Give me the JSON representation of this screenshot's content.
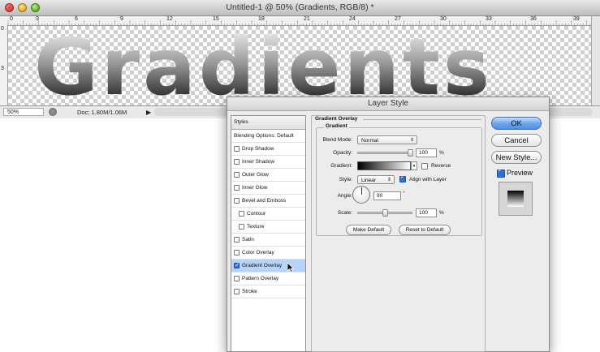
{
  "document": {
    "title": "Untitled-1 @ 50% (Gradients, RGB/8) *",
    "art_text": "Gradients",
    "ruler_marks": [
      "0",
      "3",
      "6",
      "9",
      "12",
      "15",
      "18",
      "21",
      "24",
      "27",
      "30",
      "33",
      "36",
      "39"
    ],
    "ruler_v_marks": [
      "0",
      "3"
    ],
    "status": {
      "zoom": "50%",
      "doc_info": "Doc: 1.80M/1.06M",
      "arrow": "▶"
    }
  },
  "dialog": {
    "title": "Layer Style",
    "styles_header": "Styles",
    "items": [
      {
        "label": "Blending Options: Default",
        "checkbox": false,
        "checked": false,
        "selected": false,
        "sub": false
      },
      {
        "label": "Drop Shadow",
        "checkbox": true,
        "checked": false,
        "selected": false,
        "sub": false
      },
      {
        "label": "Inner Shadow",
        "checkbox": true,
        "checked": false,
        "selected": false,
        "sub": false
      },
      {
        "label": "Outer Glow",
        "checkbox": true,
        "checked": false,
        "selected": false,
        "sub": false
      },
      {
        "label": "Inner Glow",
        "checkbox": true,
        "checked": false,
        "selected": false,
        "sub": false
      },
      {
        "label": "Bevel and Emboss",
        "checkbox": true,
        "checked": false,
        "selected": false,
        "sub": false
      },
      {
        "label": "Contour",
        "checkbox": true,
        "checked": false,
        "selected": false,
        "sub": true
      },
      {
        "label": "Texture",
        "checkbox": true,
        "checked": false,
        "selected": false,
        "sub": true
      },
      {
        "label": "Satin",
        "checkbox": true,
        "checked": false,
        "selected": false,
        "sub": false
      },
      {
        "label": "Color Overlay",
        "checkbox": true,
        "checked": false,
        "selected": false,
        "sub": false
      },
      {
        "label": "Gradient Overlay",
        "checkbox": true,
        "checked": true,
        "selected": true,
        "sub": false
      },
      {
        "label": "Pattern Overlay",
        "checkbox": true,
        "checked": false,
        "selected": false,
        "sub": false
      },
      {
        "label": "Stroke",
        "checkbox": true,
        "checked": false,
        "selected": false,
        "sub": false
      }
    ],
    "gradient_overlay": {
      "group_title": "Gradient Overlay",
      "sub_title": "Gradient",
      "blend_mode_label": "Blend Mode:",
      "blend_mode_value": "Normal",
      "opacity_label": "Opacity:",
      "opacity_value": "100",
      "opacity_fraction": 1.0,
      "percent": "%",
      "gradient_label": "Gradient:",
      "reverse_label": "Reverse",
      "reverse_checked": false,
      "style_label": "Style:",
      "style_value": "Linear",
      "align_label": "Align with Layer",
      "align_checked": true,
      "angle_label": "Angle:",
      "angle_value": "90",
      "degree": "°",
      "scale_label": "Scale:",
      "scale_value": "100",
      "scale_fraction": 0.5,
      "make_default": "Make Default",
      "reset_default": "Reset to Default"
    },
    "buttons": {
      "ok": "OK",
      "cancel": "Cancel",
      "new_style": "New Style...",
      "preview_label": "Preview",
      "preview_checked": true
    }
  },
  "colors": {
    "selection": "#b7d3f7",
    "primary_button": "#4f8fe3"
  }
}
